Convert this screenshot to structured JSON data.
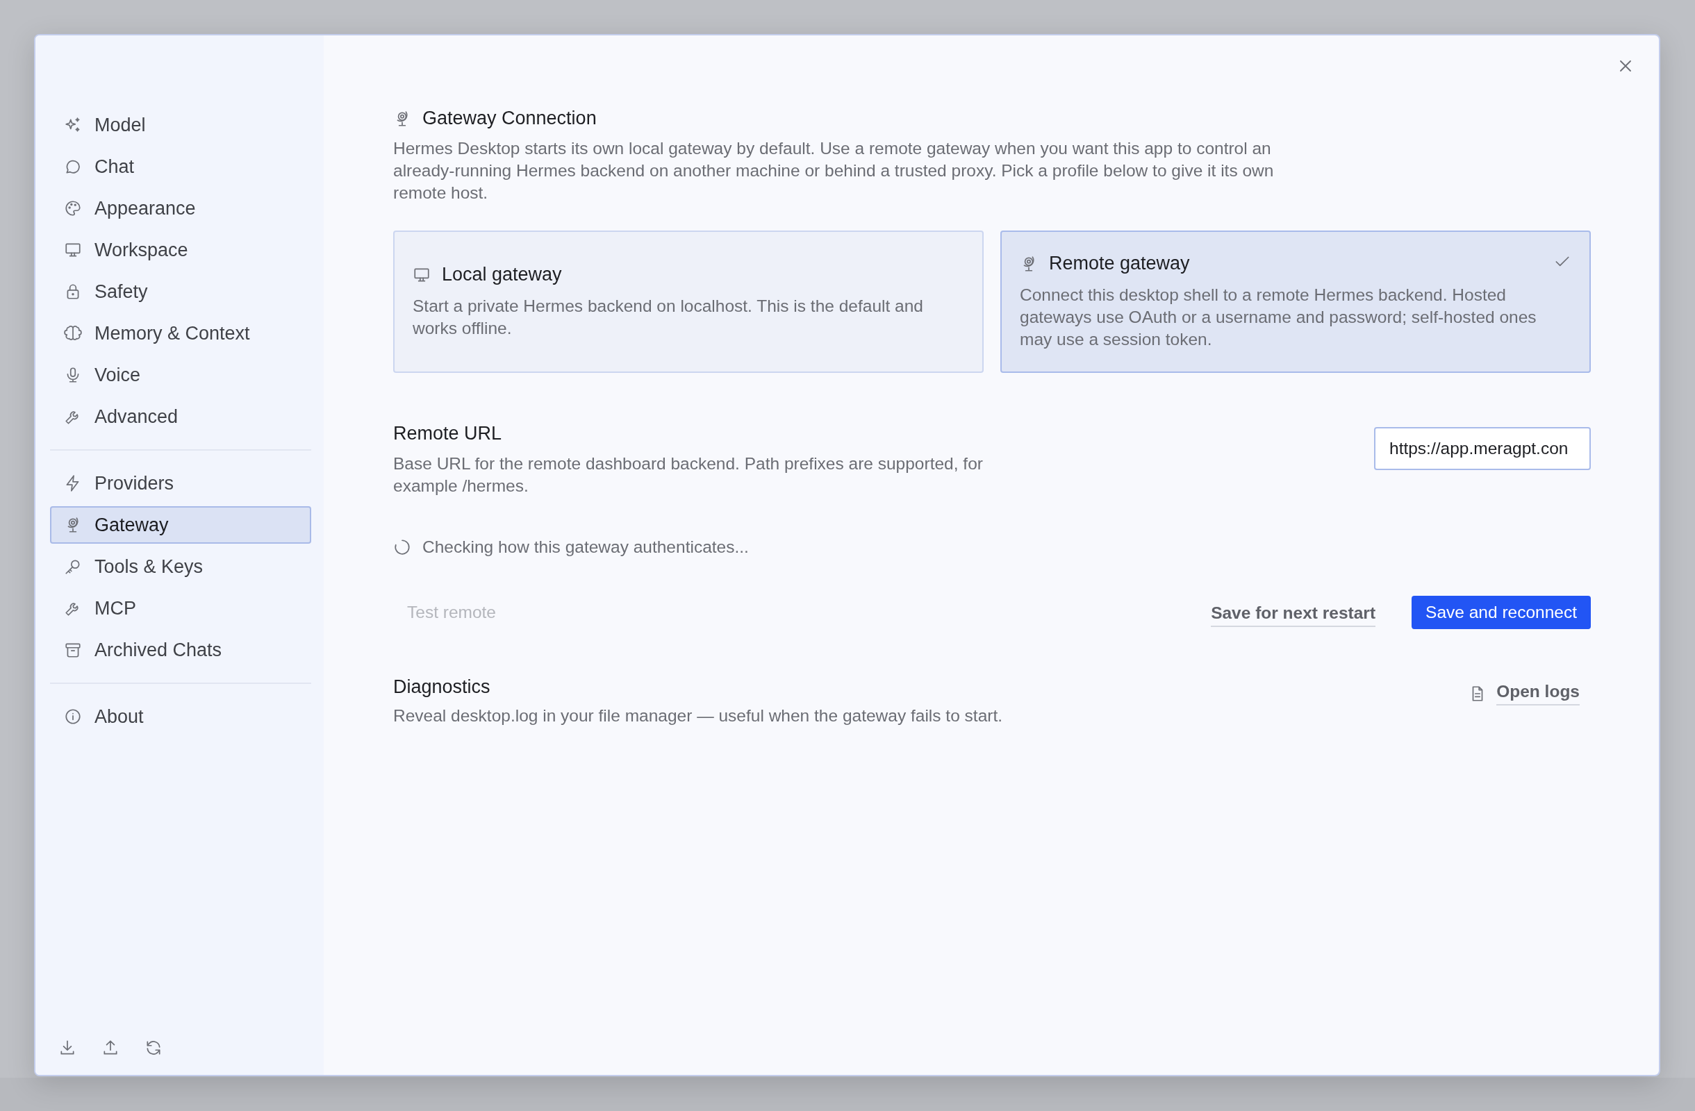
{
  "sidebar": {
    "groups": [
      [
        {
          "label": "Model",
          "selected": false
        },
        {
          "label": "Chat",
          "selected": false
        },
        {
          "label": "Appearance",
          "selected": false
        },
        {
          "label": "Workspace",
          "selected": false
        },
        {
          "label": "Safety",
          "selected": false
        },
        {
          "label": "Memory & Context",
          "selected": false
        },
        {
          "label": "Voice",
          "selected": false
        },
        {
          "label": "Advanced",
          "selected": false
        }
      ],
      [
        {
          "label": "Providers",
          "selected": false
        },
        {
          "label": "Gateway",
          "selected": true
        },
        {
          "label": "Tools & Keys",
          "selected": false
        },
        {
          "label": "MCP",
          "selected": false
        },
        {
          "label": "Archived Chats",
          "selected": false
        }
      ],
      [
        {
          "label": "About",
          "selected": false
        }
      ]
    ]
  },
  "section": {
    "title": "Gateway Connection",
    "description": "Hermes Desktop starts its own local gateway by default. Use a remote gateway when you want this app to control an already-running Hermes backend on another machine or behind a trusted proxy. Pick a profile below to give it its own remote host."
  },
  "modes": [
    {
      "title": "Local gateway",
      "description": "Start a private Hermes backend on localhost. This is the default and works offline.",
      "selected": false
    },
    {
      "title": "Remote gateway",
      "description": "Connect this desktop shell to a remote Hermes backend. Hosted gateways use OAuth or a username and password; self-hosted ones may use a session token.",
      "selected": true
    }
  ],
  "remote_url": {
    "label": "Remote URL",
    "description": "Base URL for the remote dashboard backend. Path prefixes are supported, for example /hermes.",
    "value": "https://app.meragpt.con"
  },
  "status": {
    "text": "Checking how this gateway authenticates..."
  },
  "actions": [
    {
      "kind": "ghost",
      "label": "Test remote",
      "disabled": true
    },
    {
      "kind": "link",
      "label": "Save for next restart",
      "disabled": false
    },
    {
      "kind": "primary",
      "label": "Save and reconnect",
      "disabled": false
    }
  ],
  "diagnostics": {
    "title": "Diagnostics",
    "description": "Reveal desktop.log in your file manager — useful when the gateway fails to start.",
    "button": "Open logs"
  }
}
